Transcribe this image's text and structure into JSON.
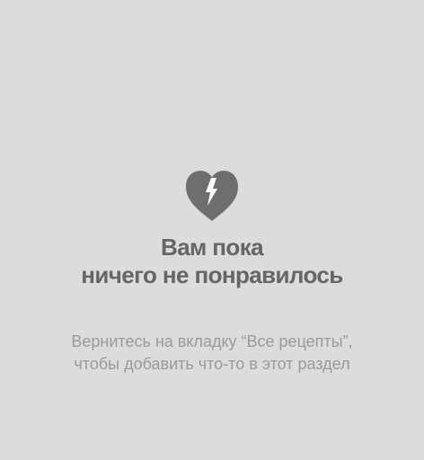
{
  "empty_state": {
    "icon": "broken-heart-icon",
    "title_line1": "Вам пока",
    "title_line2": "ничего не понравилось",
    "hint_line1": "Вернитесь на вкладку “Все рецепты”,",
    "hint_line2": "чтобы добавить что-то в этот раздел"
  },
  "colors": {
    "background": "#dcdcdc",
    "title": "#666666",
    "hint": "#9a9a9a",
    "icon": "#6e6e6e"
  }
}
